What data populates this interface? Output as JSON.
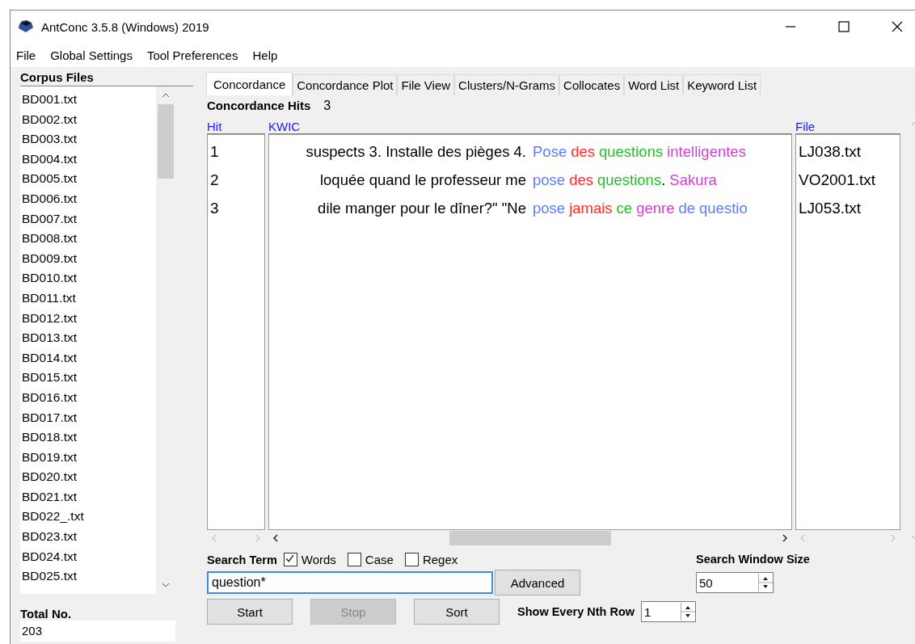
{
  "window": {
    "title": "AntConc 3.5.8 (Windows) 2019"
  },
  "menu": [
    "File",
    "Global Settings",
    "Tool Preferences",
    "Help"
  ],
  "corpus": {
    "title": "Corpus Files",
    "files": [
      "BD001.txt",
      "BD002.txt",
      "BD003.txt",
      "BD004.txt",
      "BD005.txt",
      "BD006.txt",
      "BD007.txt",
      "BD008.txt",
      "BD009.txt",
      "BD010.txt",
      "BD011.txt",
      "BD012.txt",
      "BD013.txt",
      "BD014.txt",
      "BD015.txt",
      "BD016.txt",
      "BD017.txt",
      "BD018.txt",
      "BD019.txt",
      "BD020.txt",
      "BD021.txt",
      "BD022_.txt",
      "BD023.txt",
      "BD024.txt",
      "BD025.txt"
    ],
    "total_label": "Total No.",
    "total": "203"
  },
  "tabs": [
    {
      "label": "Concordance",
      "selected": true
    },
    {
      "label": "Concordance Plot",
      "selected": false
    },
    {
      "label": "File View",
      "selected": false
    },
    {
      "label": "Clusters/N-Grams",
      "selected": false
    },
    {
      "label": "Collocates",
      "selected": false
    },
    {
      "label": "Word List",
      "selected": false
    },
    {
      "label": "Keyword List",
      "selected": false
    }
  ],
  "hits": {
    "label": "Concordance Hits",
    "count": "3"
  },
  "columns": [
    "Hit",
    "KWIC",
    "File"
  ],
  "rows": [
    {
      "hit": "1",
      "left": "suspects 3. Installe des pièges 4.",
      "file": "LJ038.txt",
      "tokens": [
        {
          "kind": "word",
          "text": "Pose",
          "color": "#5b7cff"
        },
        {
          "kind": "word",
          "text": "des",
          "color": "#ff2b2b"
        },
        {
          "kind": "word",
          "text": "questions",
          "color": "#22c222"
        },
        {
          "kind": "word",
          "text": "intelligentes",
          "color": "#d040d0"
        }
      ]
    },
    {
      "hit": "2",
      "left": "loquée quand le professeur me",
      "file": "VO2001.txt",
      "tokens": [
        {
          "kind": "word",
          "text": "pose",
          "color": "#5b7cff"
        },
        {
          "kind": "word",
          "text": "des",
          "color": "#ff2b2b"
        },
        {
          "kind": "word",
          "text": "questions",
          "color": "#22c222"
        },
        {
          "kind": "punct",
          "text": "."
        },
        {
          "kind": "word",
          "text": "Sakura",
          "color": "#d040d0"
        }
      ]
    },
    {
      "hit": "3",
      "left": "dile manger pour le dîner?\" \"Ne",
      "file": "LJ053.txt",
      "tokens": [
        {
          "kind": "word",
          "text": "pose",
          "color": "#5b7cff"
        },
        {
          "kind": "word",
          "text": "jamais",
          "color": "#ff2b2b"
        },
        {
          "kind": "word",
          "text": "ce",
          "color": "#22c222"
        },
        {
          "kind": "word",
          "text": "genre",
          "color": "#d040d0"
        },
        {
          "kind": "word",
          "text": "de",
          "color": "#5b7cff"
        },
        {
          "kind": "word",
          "text": "questio",
          "color": "#5b7cff"
        }
      ]
    }
  ],
  "search": {
    "label": "Search Term",
    "options": [
      {
        "label": "Words",
        "checked": true
      },
      {
        "label": "Case",
        "checked": false
      },
      {
        "label": "Regex",
        "checked": false
      }
    ],
    "value": "question*",
    "advanced": "Advanced",
    "window_label": "Search Window Size",
    "window_value": "50",
    "buttons": [
      {
        "label": "Start",
        "disabled": false
      },
      {
        "label": "Stop",
        "disabled": true
      },
      {
        "label": "Sort",
        "disabled": false
      }
    ],
    "nth_label": "Show Every Nth Row",
    "nth_value": "1"
  }
}
